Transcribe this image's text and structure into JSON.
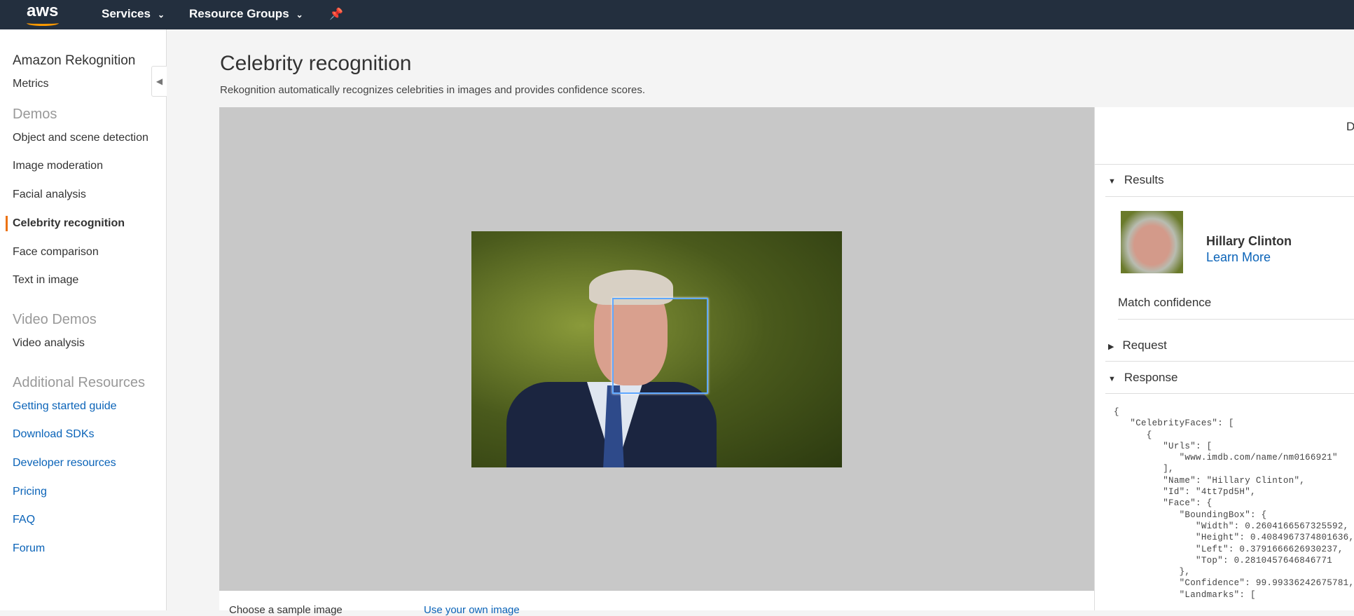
{
  "topbar": {
    "logo": "aws",
    "services": "Services",
    "resource_groups": "Resource Groups",
    "pin_icon": "pin-icon"
  },
  "sidebar": {
    "title": "Amazon Rekognition",
    "metrics": "Metrics",
    "demos_heading": "Demos",
    "demos": [
      "Object and scene detection",
      "Image moderation",
      "Facial analysis",
      "Celebrity recognition",
      "Face comparison",
      "Text in image"
    ],
    "active": "Celebrity recognition",
    "video_heading": "Video Demos",
    "video": [
      "Video analysis"
    ],
    "resources_heading": "Additional Resources",
    "resources": [
      "Getting started guide",
      "Download SDKs",
      "Developer resources",
      "Pricing",
      "FAQ",
      "Forum"
    ]
  },
  "main": {
    "title": "Celebrity recognition",
    "subtitle": "Rekognition automatically recognizes celebrities in images and provides confidence scores.",
    "sample_label": "Choose a sample image",
    "own_label": "Use your own image"
  },
  "panel": {
    "cut_text": "D",
    "results": "Results",
    "celebrity_name": "Hillary Clinton",
    "learn_more": "Learn More",
    "match_confidence": "Match confidence",
    "request": "Request",
    "response": "Response",
    "response_json": "{\n   \"CelebrityFaces\": [\n      {\n         \"Urls\": [\n            \"www.imdb.com/name/nm0166921\"\n         ],\n         \"Name\": \"Hillary Clinton\",\n         \"Id\": \"4tt7pd5H\",\n         \"Face\": {\n            \"BoundingBox\": {\n               \"Width\": 0.2604166567325592,\n               \"Height\": 0.4084967374801636,\n               \"Left\": 0.3791666626930237,\n               \"Top\": 0.2810457646846771\n            },\n            \"Confidence\": 99.99336242675781,\n            \"Landmarks\": ["
  },
  "colors": {
    "topbar": "#232f3e",
    "accent": "#ec7211",
    "link": "#0a63b8",
    "face_box": "#5fa8ff"
  }
}
